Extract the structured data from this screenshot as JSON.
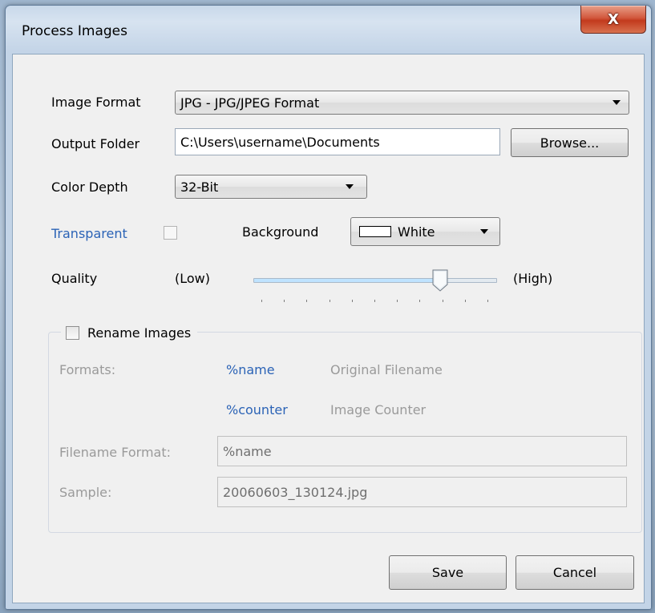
{
  "window": {
    "title": "Process Images",
    "close_glyph": "X"
  },
  "form": {
    "image_format": {
      "label": "Image Format",
      "selected": "JPG - JPG/JPEG Format"
    },
    "output_folder": {
      "label": "Output Folder",
      "value": "C:\\Users\\username\\Documents",
      "browse_label": "Browse..."
    },
    "color_depth": {
      "label": "Color Depth",
      "selected": "32-Bit"
    },
    "transparent": {
      "label": "Transparent",
      "checked": false
    },
    "background": {
      "label": "Background",
      "selected": "White",
      "swatch_color": "#ffffff"
    },
    "quality": {
      "label": "Quality",
      "low_label": "(Low)",
      "high_label": "(High)",
      "value_fraction": 0.77,
      "tick_count": 11
    }
  },
  "rename": {
    "header_label": "Rename Images",
    "checked": false,
    "formats_label": "Formats:",
    "tokens": [
      {
        "token": "%name",
        "description": "Original Filename"
      },
      {
        "token": "%counter",
        "description": "Image Counter"
      }
    ],
    "filename_format_label": "Filename Format:",
    "filename_format_value": "%name",
    "sample_label": "Sample:",
    "sample_value": "20060603_130124.jpg"
  },
  "actions": {
    "save_label": "Save",
    "cancel_label": "Cancel"
  },
  "colors": {
    "link_blue": "#2b63b6",
    "disabled_gray": "#9a9a9a",
    "close_red": "#c23a1d"
  }
}
